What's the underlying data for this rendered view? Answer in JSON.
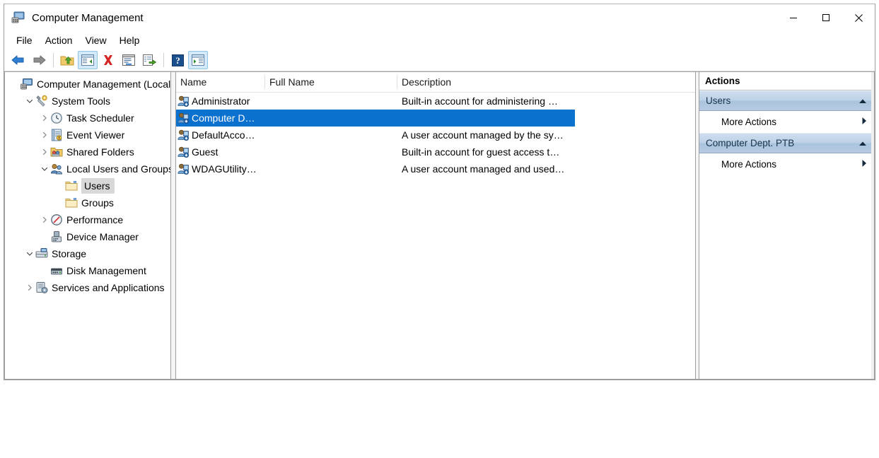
{
  "window": {
    "title": "Computer Management",
    "icon": "computer-icon",
    "controls": {
      "minimize": "minimize-icon",
      "maximize": "maximize-icon",
      "close": "close-icon"
    }
  },
  "menubar": {
    "items": [
      {
        "label": "File"
      },
      {
        "label": "Action"
      },
      {
        "label": "View"
      },
      {
        "label": "Help"
      }
    ]
  },
  "toolbar": {
    "buttons": [
      {
        "name": "back-button",
        "icon": "back-arrow-icon",
        "active": false
      },
      {
        "name": "forward-button",
        "icon": "forward-arrow-icon",
        "active": false
      },
      {
        "name": "separator-1",
        "icon": "separator",
        "active": false
      },
      {
        "name": "up-one-level-button",
        "icon": "folder-up-icon",
        "active": false
      },
      {
        "name": "show-console-tree-button",
        "icon": "console-tree-icon",
        "active": true
      },
      {
        "name": "delete-button",
        "icon": "red-x-icon",
        "active": false
      },
      {
        "name": "properties-button",
        "icon": "properties-icon",
        "active": false
      },
      {
        "name": "export-list-button",
        "icon": "export-list-icon",
        "active": false
      },
      {
        "name": "separator-2",
        "icon": "separator",
        "active": false
      },
      {
        "name": "help-button",
        "icon": "question-mark-icon",
        "active": false
      },
      {
        "name": "show-action-pane-button",
        "icon": "action-pane-icon",
        "active": true
      }
    ]
  },
  "tree": {
    "items": [
      {
        "label": "Computer Management (Local)",
        "indent": 0,
        "expander": "none",
        "icon": "computer-icon",
        "selected": false
      },
      {
        "label": "System Tools",
        "indent": 1,
        "expander": "expanded",
        "icon": "system-tools-icon",
        "selected": false
      },
      {
        "label": "Task Scheduler",
        "indent": 2,
        "expander": "collapsed",
        "icon": "clock-icon",
        "selected": false
      },
      {
        "label": "Event Viewer",
        "indent": 2,
        "expander": "collapsed",
        "icon": "event-viewer-icon",
        "selected": false
      },
      {
        "label": "Shared Folders",
        "indent": 2,
        "expander": "collapsed",
        "icon": "shared-folders-icon",
        "selected": false
      },
      {
        "label": "Local Users and Groups",
        "indent": 2,
        "expander": "expanded",
        "icon": "users-groups-icon",
        "selected": false
      },
      {
        "label": "Users",
        "indent": 3,
        "expander": "none",
        "icon": "folder-icon",
        "selected": true
      },
      {
        "label": "Groups",
        "indent": 3,
        "expander": "none",
        "icon": "folder-icon",
        "selected": false
      },
      {
        "label": "Performance",
        "indent": 2,
        "expander": "collapsed",
        "icon": "performance-icon",
        "selected": false
      },
      {
        "label": "Device Manager",
        "indent": 2,
        "expander": "none",
        "icon": "device-manager-icon",
        "selected": false
      },
      {
        "label": "Storage",
        "indent": 1,
        "expander": "expanded",
        "icon": "storage-icon",
        "selected": false
      },
      {
        "label": "Disk Management",
        "indent": 2,
        "expander": "none",
        "icon": "disk-management-icon",
        "selected": false
      },
      {
        "label": "Services and Applications",
        "indent": 1,
        "expander": "collapsed",
        "icon": "services-icon",
        "selected": false
      }
    ]
  },
  "list": {
    "columns": [
      "Name",
      "Full Name",
      "Description"
    ],
    "rows": [
      {
        "name": "Administrator",
        "full_name": "",
        "description": "Built-in account for administering …",
        "selected": false,
        "icon": "user-account-icon"
      },
      {
        "name": "Computer D…",
        "full_name": "",
        "description": "",
        "selected": true,
        "icon": "user-account-icon"
      },
      {
        "name": "DefaultAcco…",
        "full_name": "",
        "description": "A user account managed by the sy…",
        "selected": false,
        "icon": "user-account-icon"
      },
      {
        "name": "Guest",
        "full_name": "",
        "description": "Built-in account for guest access t…",
        "selected": false,
        "icon": "user-account-icon"
      },
      {
        "name": "WDAGUtility…",
        "full_name": "",
        "description": "A user account managed and used…",
        "selected": false,
        "icon": "user-account-icon"
      }
    ]
  },
  "actions": {
    "title": "Actions",
    "sections": [
      {
        "label": "Users",
        "chevron": "chevron-up-icon",
        "items": [
          {
            "label": "More Actions",
            "chevron": "chevron-right-icon"
          }
        ]
      },
      {
        "label": "Computer Dept. PTB",
        "chevron": "chevron-up-icon",
        "items": [
          {
            "label": "More Actions",
            "chevron": "chevron-right-icon"
          }
        ]
      }
    ]
  },
  "colors": {
    "selection_blue": "#0b71ce",
    "section_header_blue": "#bcd0e5",
    "toolbar_active": "#d3e8f9",
    "tree_selection_gray": "#d8d8d8"
  }
}
